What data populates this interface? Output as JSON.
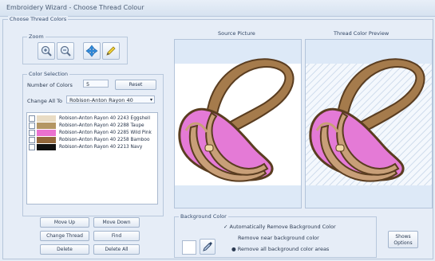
{
  "window": {
    "title": "Embroidery Wizard - Choose Thread Colour"
  },
  "main_group": {
    "label": "Choose Thread Colors"
  },
  "zoom": {
    "label": "Zoom",
    "tools": [
      "zoom-in-icon",
      "zoom-out-icon",
      "pan-icon",
      "pencil-icon"
    ]
  },
  "colors": {
    "label": "Color Selection",
    "number_label": "Number of Colors",
    "number_value": "5",
    "reset_label": "Reset",
    "change_all_label": "Change All To",
    "change_all_value": "Robison-Anton Rayon 40",
    "threads": [
      {
        "checked": false,
        "swatch": "#e9dcc4",
        "name": "Robison-Anton Rayon 40 2243 Eggshell"
      },
      {
        "checked": false,
        "swatch": "#b49664",
        "name": "Robison-Anton Rayon 40 2288 Taupe"
      },
      {
        "checked": false,
        "swatch": "#ea72cf",
        "name": "Robison-Anton Rayon 40 2285 Wild Pink"
      },
      {
        "checked": false,
        "swatch": "#93683c",
        "name": "Robison-Anton Rayon 40 2258 Bamboo"
      },
      {
        "checked": false,
        "swatch": "#111111",
        "name": "Robison-Anton Rayon 40 2213 Navy"
      }
    ],
    "buttons": {
      "move_up": "Move Up",
      "move_down": "Move Down",
      "change_thread": "Change Thread",
      "find": "Find",
      "delete": "Delete",
      "delete_all": "Delete All"
    }
  },
  "preview": {
    "source_title": "Source Picture",
    "thread_title": "Thread Color Preview"
  },
  "background": {
    "label": "Background Color",
    "auto_remove": "Automatically Remove Background Color",
    "remove_near": "Remove near background color",
    "remove_all": "Remove all background color areas"
  },
  "more_options": {
    "line1": "Shows",
    "line2": "Options"
  },
  "palette": {
    "outline": "#6a4a2a",
    "strap": "#9c7448",
    "pink": "#e47ad6",
    "tan": "#c89f78"
  }
}
